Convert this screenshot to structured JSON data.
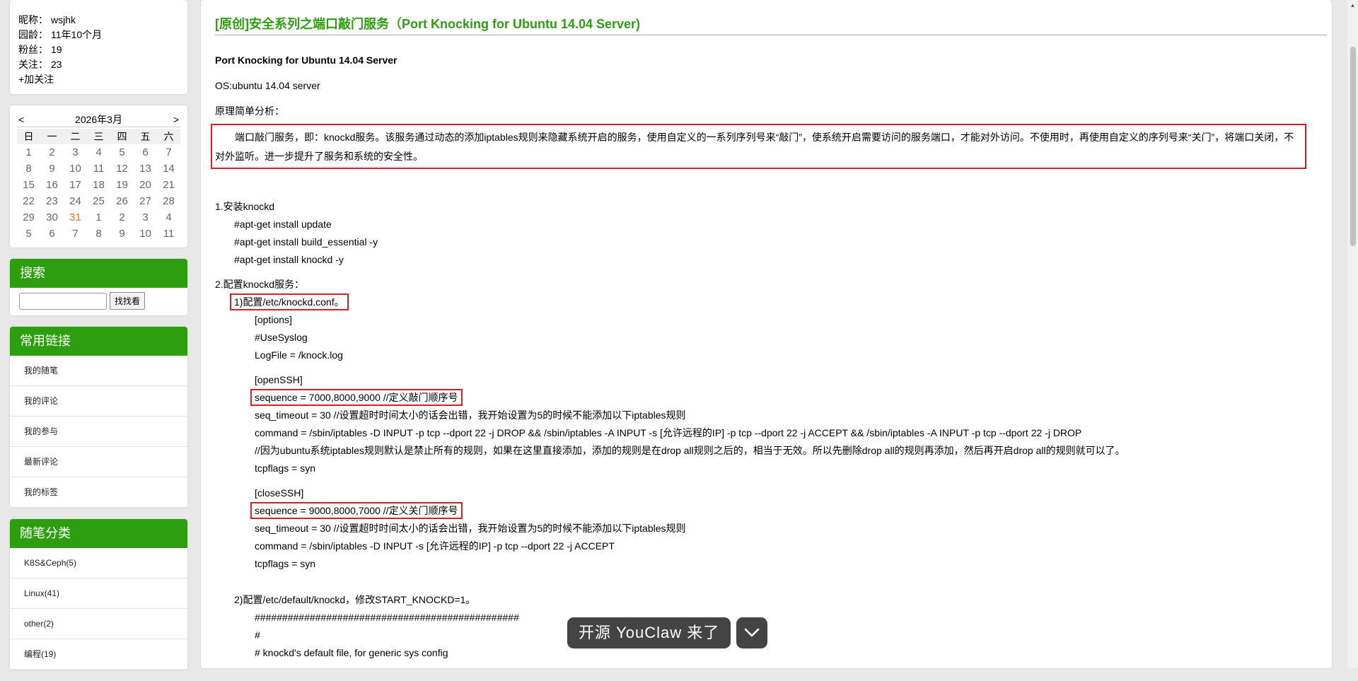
{
  "profile": {
    "rows": [
      {
        "label": "昵称：",
        "value": "wsjhk"
      },
      {
        "label": "园龄：",
        "value": "11年10个月"
      },
      {
        "label": "粉丝：",
        "value": "19"
      },
      {
        "label": "关注：",
        "value": "23"
      }
    ],
    "follow": "+加关注"
  },
  "calendar": {
    "prev": "<",
    "next": ">",
    "month": "2026年3月",
    "weekdays": [
      "日",
      "一",
      "二",
      "三",
      "四",
      "五",
      "六"
    ],
    "weeks": [
      [
        "1",
        "2",
        "3",
        "4",
        "5",
        "6",
        "7"
      ],
      [
        "8",
        "9",
        "10",
        "11",
        "12",
        "13",
        "14"
      ],
      [
        "15",
        "16",
        "17",
        "18",
        "19",
        "20",
        "21"
      ],
      [
        "22",
        "23",
        "24",
        "25",
        "26",
        "27",
        "28"
      ],
      [
        "29",
        "30",
        "31",
        "1",
        "2",
        "3",
        "4"
      ],
      [
        "5",
        "6",
        "7",
        "8",
        "9",
        "10",
        "11"
      ]
    ],
    "today": "31"
  },
  "search": {
    "title": "搜索",
    "button": "找找看",
    "value": ""
  },
  "links": {
    "title": "常用链接",
    "items": [
      "我的随笔",
      "我的评论",
      "我的参与",
      "最新评论",
      "我的标签"
    ]
  },
  "categories": {
    "title": "随笔分类",
    "items": [
      "K8S&Ceph(5)",
      "Linux(41)",
      "other(2)",
      "编程(19)"
    ]
  },
  "post": {
    "title": "[原创]安全系列之端口敲门服务（Port Knocking for Ubuntu 14.04 Server)",
    "heading": "Port Knocking for Ubuntu 14.04 Server",
    "os": "OS:ubuntu 14.04 server",
    "principle": "原理简单分析：",
    "intro": "端口敲门服务，即：knockd服务。该服务通过动态的添加iptables规则来隐藏系统开启的服务，使用自定义的一系列序列号来“敲门”，使系统开启需要访问的服务端口，才能对外访问。不使用时，再使用自定义的序列号来“关门”，将端口关闭，不对外监听。进一步提升了服务和系统的安全性。",
    "step1": "1.安装knockd",
    "install": [
      "#apt-get install update",
      "#apt-get install build_essential -y",
      "#apt-get install knockd -y"
    ],
    "step2": "2.配置knockd服务：",
    "conf1": "1)配置/etc/knockd.conf。",
    "options": [
      "[options]",
      "#UseSyslog",
      "LogFile = /knock.log"
    ],
    "open_section": "[openSSH]",
    "open_seq": "sequence = 7000,8000,9000 //定义敲门顺序号",
    "open_lines": [
      "seq_timeout = 30 //设置超时时间太小的话会出错，我开始设置为5的时候不能添加以下iptables规则",
      "command = /sbin/iptables -D INPUT -p tcp --dport 22 -j DROP && /sbin/iptables -A INPUT -s [允许远程的IP] -p tcp --dport 22 -j ACCEPT && /sbin/iptables -A INPUT -p tcp --dport 22 -j DROP",
      "//因为ubuntu系统iptables规则默认是禁止所有的规则，如果在这里直接添加，添加的规则是在drop all规则之后的，相当于无效。所以先删除drop all的规则再添加，然后再开启drop all的规则就可以了。",
      "tcpflags = syn"
    ],
    "close_section": "[closeSSH]",
    "close_seq": "sequence = 9000,8000,7000 //定义关门顺序号",
    "close_lines": [
      "seq_timeout = 30 //设置超时时间太小的话会出错，我开始设置为5的时候不能添加以下iptables规则",
      "command = /sbin/iptables -D INPUT -s [允许远程的IP] -p tcp --dport 22 -j ACCEPT",
      "tcpflags = syn"
    ],
    "conf2": "2)配置/etc/default/knockd，修改START_KNOCKD=1。",
    "default_lines": [
      "################################################",
      "#",
      "# knockd's default file, for generic sys config"
    ]
  },
  "banner": {
    "text": "开源 YouClaw 来了"
  }
}
